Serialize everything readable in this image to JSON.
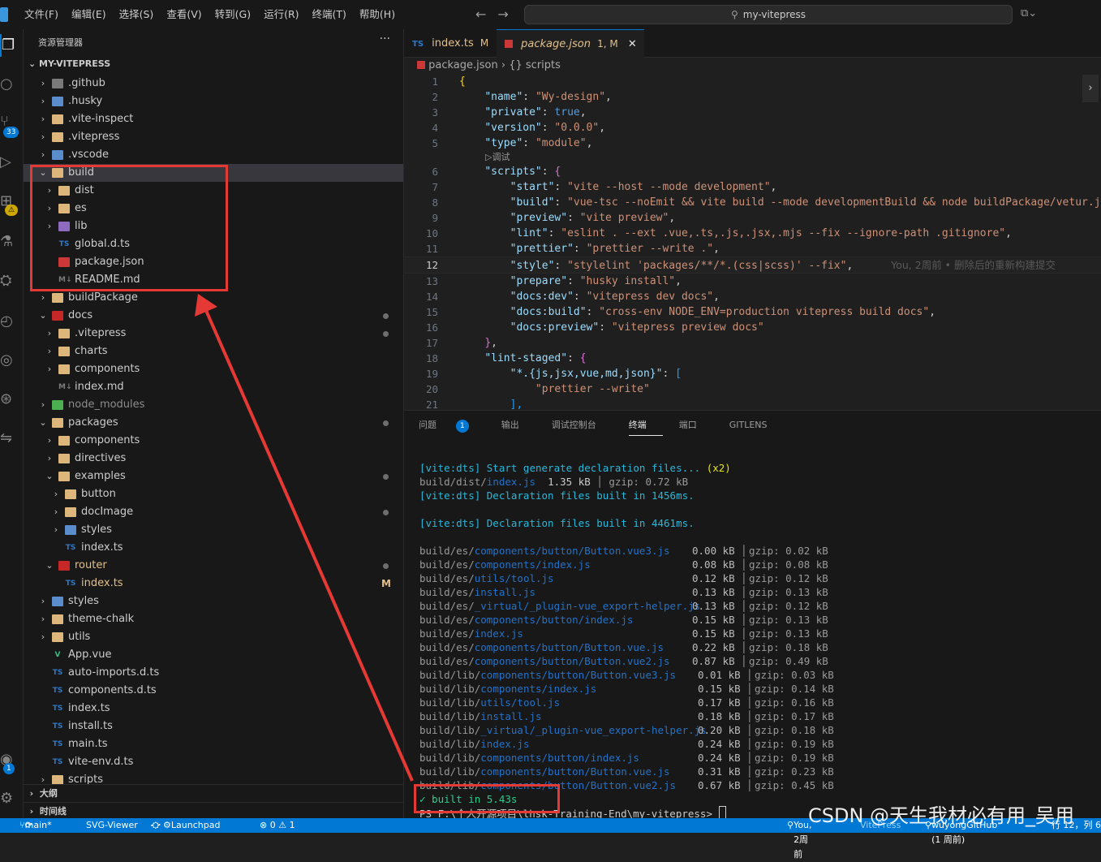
{
  "menu": [
    "文件(F)",
    "编辑(E)",
    "选择(S)",
    "查看(V)",
    "转到(G)",
    "运行(R)",
    "终端(T)",
    "帮助(H)"
  ],
  "search": {
    "text": "my-vitepress"
  },
  "activity_badges": {
    "scm": "33",
    "warn": "⚠",
    "account": "1"
  },
  "sidebar": {
    "title": "资源管理器",
    "more": "···",
    "root": "MY-VITEPRESS",
    "items": [
      {
        "label": ".github",
        "depth": 0,
        "chev": "›",
        "icon": "f-gray",
        "name": "folder-icon"
      },
      {
        "label": ".husky",
        "depth": 0,
        "chev": "›",
        "icon": "f-blue",
        "name": "folder-icon"
      },
      {
        "label": ".vite-inspect",
        "depth": 0,
        "chev": "›",
        "icon": "f-folder",
        "name": "folder-icon"
      },
      {
        "label": ".vitepress",
        "depth": 0,
        "chev": "›",
        "icon": "f-folder",
        "name": "folder-icon"
      },
      {
        "label": ".vscode",
        "depth": 0,
        "chev": "›",
        "icon": "f-blue",
        "name": "folder-icon"
      },
      {
        "label": "build",
        "depth": 0,
        "chev": "⌄",
        "icon": "f-folder",
        "name": "folder-open-icon",
        "sel": true
      },
      {
        "label": "dist",
        "depth": 1,
        "chev": "›",
        "icon": "f-folder",
        "name": "folder-icon"
      },
      {
        "label": "es",
        "depth": 1,
        "chev": "›",
        "icon": "f-folder",
        "name": "folder-icon"
      },
      {
        "label": "lib",
        "depth": 1,
        "chev": "›",
        "icon": "f-purple",
        "name": "folder-icon"
      },
      {
        "label": "global.d.ts",
        "depth": 1,
        "chev": "",
        "icon": "ts",
        "glyph": "TS",
        "name": "typescript-file-icon"
      },
      {
        "label": "package.json",
        "depth": 1,
        "chev": "",
        "icon": "pj",
        "glyph": "",
        "name": "npm-file-icon"
      },
      {
        "label": "README.md",
        "depth": 1,
        "chev": "",
        "icon": "md",
        "glyph": "M↓",
        "name": "markdown-file-icon"
      },
      {
        "label": "buildPackage",
        "depth": 0,
        "chev": "›",
        "icon": "f-folder",
        "name": "folder-icon"
      },
      {
        "label": "docs",
        "depth": 0,
        "chev": "⌄",
        "icon": "f-red",
        "name": "folder-open-icon",
        "dot": true
      },
      {
        "label": ".vitepress",
        "depth": 1,
        "chev": "›",
        "icon": "f-folder",
        "name": "folder-icon",
        "dot": true
      },
      {
        "label": "charts",
        "depth": 1,
        "chev": "›",
        "icon": "f-folder",
        "name": "folder-icon"
      },
      {
        "label": "components",
        "depth": 1,
        "chev": "›",
        "icon": "f-folder",
        "name": "folder-icon"
      },
      {
        "label": "index.md",
        "depth": 1,
        "chev": "",
        "icon": "md",
        "glyph": "M↓",
        "name": "markdown-file-icon"
      },
      {
        "label": "node_modules",
        "depth": 0,
        "chev": "›",
        "icon": "f-green",
        "name": "folder-icon",
        "dim": true
      },
      {
        "label": "packages",
        "depth": 0,
        "chev": "⌄",
        "icon": "f-folder",
        "name": "folder-open-icon",
        "dot": true
      },
      {
        "label": "components",
        "depth": 1,
        "chev": "›",
        "icon": "f-folder",
        "name": "folder-icon"
      },
      {
        "label": "directives",
        "depth": 1,
        "chev": "›",
        "icon": "f-folder",
        "name": "folder-icon"
      },
      {
        "label": "examples",
        "depth": 1,
        "chev": "⌄",
        "icon": "f-folder",
        "name": "folder-open-icon",
        "dot": true
      },
      {
        "label": "button",
        "depth": 2,
        "chev": "›",
        "icon": "f-folder",
        "name": "folder-icon"
      },
      {
        "label": "docImage",
        "depth": 2,
        "chev": "›",
        "icon": "f-folder",
        "name": "folder-icon",
        "dot": true
      },
      {
        "label": "styles",
        "depth": 2,
        "chev": "›",
        "icon": "f-blue",
        "name": "folder-icon"
      },
      {
        "label": "index.ts",
        "depth": 2,
        "chev": "",
        "icon": "ts",
        "glyph": "TS",
        "name": "typescript-file-icon"
      },
      {
        "label": "router",
        "depth": 1,
        "chev": "⌄",
        "icon": "f-red",
        "name": "folder-open-icon",
        "dot": true,
        "mod": true
      },
      {
        "label": "index.ts",
        "depth": 2,
        "chev": "",
        "icon": "ts",
        "glyph": "TS",
        "name": "typescript-file-icon",
        "mark": "M",
        "mod": true
      },
      {
        "label": "styles",
        "depth": 0,
        "chev": "›",
        "icon": "f-blue",
        "name": "folder-icon"
      },
      {
        "label": "theme-chalk",
        "depth": 0,
        "chev": "›",
        "icon": "f-folder",
        "name": "folder-icon"
      },
      {
        "label": "utils",
        "depth": 0,
        "chev": "›",
        "icon": "f-folder",
        "name": "folder-icon"
      },
      {
        "label": "App.vue",
        "depth": 0,
        "chev": "",
        "icon": "vue",
        "glyph": "V",
        "name": "vue-file-icon"
      },
      {
        "label": "auto-imports.d.ts",
        "depth": 0,
        "chev": "",
        "icon": "ts",
        "glyph": "TS",
        "name": "typescript-file-icon"
      },
      {
        "label": "components.d.ts",
        "depth": 0,
        "chev": "",
        "icon": "ts",
        "glyph": "TS",
        "name": "typescript-file-icon"
      },
      {
        "label": "index.ts",
        "depth": 0,
        "chev": "",
        "icon": "ts",
        "glyph": "TS",
        "name": "typescript-file-icon"
      },
      {
        "label": "install.ts",
        "depth": 0,
        "chev": "",
        "icon": "ts",
        "glyph": "TS",
        "name": "typescript-file-icon"
      },
      {
        "label": "main.ts",
        "depth": 0,
        "chev": "",
        "icon": "ts",
        "glyph": "TS",
        "name": "typescript-file-icon"
      },
      {
        "label": "vite-env.d.ts",
        "depth": 0,
        "chev": "",
        "icon": "ts",
        "glyph": "TS",
        "name": "typescript-file-icon"
      },
      {
        "label": "scripts",
        "depth": -1,
        "chev": "›",
        "icon": "f-folder",
        "name": "folder-icon"
      }
    ],
    "outline": "大纲",
    "timeline": "时间线"
  },
  "tabs": [
    {
      "lang": "TS",
      "label": "index.ts",
      "status": "M"
    },
    {
      "label": "package.json",
      "status": "1, M",
      "close": "✕"
    }
  ],
  "breadcrumb": {
    "file": "package.json",
    "sep": "›",
    "node": "{} scripts"
  },
  "codelens": "▷调试",
  "blame": "You, 2周前 • 删除后的重新构建提交",
  "current_line": 12,
  "code": [
    [
      [
        "{",
        "p1"
      ]
    ],
    [
      [
        "    ",
        ""
      ],
      [
        "\"name\"",
        "k"
      ],
      [
        ": ",
        ""
      ],
      [
        "\"Wy-design\"",
        "s"
      ],
      [
        ",",
        ""
      ]
    ],
    [
      [
        "    ",
        ""
      ],
      [
        "\"private\"",
        "k"
      ],
      [
        ": ",
        ""
      ],
      [
        "true",
        "b"
      ],
      [
        ",",
        ""
      ]
    ],
    [
      [
        "    ",
        ""
      ],
      [
        "\"version\"",
        "k"
      ],
      [
        ": ",
        ""
      ],
      [
        "\"0.0.0\"",
        "s"
      ],
      [
        ",",
        ""
      ]
    ],
    [
      [
        "    ",
        ""
      ],
      [
        "\"type\"",
        "k"
      ],
      [
        ": ",
        ""
      ],
      [
        "\"module\"",
        "s"
      ],
      [
        ",",
        ""
      ]
    ],
    [
      [
        "    ",
        ""
      ],
      [
        "\"scripts\"",
        "k"
      ],
      [
        ": ",
        ""
      ],
      [
        "{",
        "p2"
      ]
    ],
    [
      [
        "        ",
        ""
      ],
      [
        "\"start\"",
        "k"
      ],
      [
        ": ",
        ""
      ],
      [
        "\"vite --host --mode development\"",
        "s"
      ],
      [
        ",",
        ""
      ]
    ],
    [
      [
        "        ",
        ""
      ],
      [
        "\"build\"",
        "k"
      ],
      [
        ": ",
        ""
      ],
      [
        "\"vue-tsc --noEmit && vite build --mode developmentBuild && node buildPackage/vetur.js",
        "s"
      ]
    ],
    [
      [
        "        ",
        ""
      ],
      [
        "\"preview\"",
        "k"
      ],
      [
        ": ",
        ""
      ],
      [
        "\"vite preview\"",
        "s"
      ],
      [
        ",",
        ""
      ]
    ],
    [
      [
        "        ",
        ""
      ],
      [
        "\"lint\"",
        "k"
      ],
      [
        ": ",
        ""
      ],
      [
        "\"eslint . --ext .vue,.ts,.js,.jsx,.mjs --fix --ignore-path .gitignore\"",
        "s"
      ],
      [
        ",",
        ""
      ]
    ],
    [
      [
        "        ",
        ""
      ],
      [
        "\"prettier\"",
        "k"
      ],
      [
        ": ",
        ""
      ],
      [
        "\"prettier --write .\"",
        "s"
      ],
      [
        ",",
        ""
      ]
    ],
    [
      [
        "        ",
        ""
      ],
      [
        "\"style\"",
        "k"
      ],
      [
        ": ",
        ""
      ],
      [
        "\"stylelint 'packages/**/*.(css|scss)' --fix\"",
        "s"
      ],
      [
        ",",
        ""
      ]
    ],
    [
      [
        "        ",
        ""
      ],
      [
        "\"prepare\"",
        "k"
      ],
      [
        ": ",
        ""
      ],
      [
        "\"husky install\"",
        "s"
      ],
      [
        ",",
        ""
      ]
    ],
    [
      [
        "        ",
        ""
      ],
      [
        "\"docs:dev\"",
        "k"
      ],
      [
        ": ",
        ""
      ],
      [
        "\"vitepress dev docs\"",
        "s"
      ],
      [
        ",",
        ""
      ]
    ],
    [
      [
        "        ",
        ""
      ],
      [
        "\"docs:build\"",
        "k"
      ],
      [
        ": ",
        ""
      ],
      [
        "\"cross-env NODE_ENV=production vitepress build docs\"",
        "s"
      ],
      [
        ",",
        ""
      ]
    ],
    [
      [
        "        ",
        ""
      ],
      [
        "\"docs:preview\"",
        "k"
      ],
      [
        ": ",
        ""
      ],
      [
        "\"vitepress preview docs\"",
        "s"
      ]
    ],
    [
      [
        "    ",
        ""
      ],
      [
        "}",
        "p2"
      ],
      [
        ",",
        ""
      ]
    ],
    [
      [
        "    ",
        ""
      ],
      [
        "\"lint-staged\"",
        "k"
      ],
      [
        ": ",
        ""
      ],
      [
        "{",
        "p2"
      ]
    ],
    [
      [
        "        ",
        ""
      ],
      [
        "\"*.{js,jsx,vue,md,json}\"",
        "k"
      ],
      [
        ": ",
        ""
      ],
      [
        "[",
        "p3"
      ]
    ],
    [
      [
        "            ",
        ""
      ],
      [
        "\"prettier --write\"",
        "s"
      ]
    ],
    [
      [
        "        ",
        ""
      ],
      [
        "],",
        "p3"
      ]
    ]
  ],
  "panel": {
    "tabs": [
      "问题",
      "输出",
      "调试控制台",
      "终端",
      "端口",
      "GITLENS"
    ],
    "problems_count": "1",
    "active": "终端"
  },
  "terminal": {
    "pre": [
      {
        "a": "[vite:dts] Start generate declaration files... ",
        "b": "(x2)"
      },
      {
        "p1": "build/dist/",
        "p2": "index.js",
        "sz": "  1.35 kB",
        "gz": "│ gzip: 0.72 kB",
        "inline": true
      },
      {
        "a": "[vite:dts] Declaration files built in 1456ms."
      },
      {
        "blank": true
      },
      {
        "a": "[vite:dts] Declaration files built in 4461ms."
      },
      {
        "blank": true
      }
    ],
    "files": [
      [
        "build/es/",
        "components/button/Button.vue3.js",
        "0.00 kB",
        "gzip: 0.02 kB"
      ],
      [
        "build/es/",
        "components/index.js",
        "0.08 kB",
        "gzip: 0.08 kB"
      ],
      [
        "build/es/",
        "utils/tool.js",
        "0.12 kB",
        "gzip: 0.12 kB"
      ],
      [
        "build/es/",
        "install.js",
        "0.13 kB",
        "gzip: 0.13 kB"
      ],
      [
        "build/es/",
        "_virtual/_plugin-vue_export-helper.js",
        "0.13 kB",
        "gzip: 0.12 kB"
      ],
      [
        "build/es/",
        "components/button/index.js",
        "0.15 kB",
        "gzip: 0.13 kB"
      ],
      [
        "build/es/",
        "index.js",
        "0.15 kB",
        "gzip: 0.13 kB"
      ],
      [
        "build/es/",
        "components/button/Button.vue.js",
        "0.22 kB",
        "gzip: 0.18 kB"
      ],
      [
        "build/es/",
        "components/button/Button.vue2.js",
        "0.87 kB",
        "gzip: 0.49 kB"
      ],
      [
        "build/lib/",
        "components/button/Button.vue3.js",
        "0.01 kB",
        "gzip: 0.03 kB"
      ],
      [
        "build/lib/",
        "components/index.js",
        "0.15 kB",
        "gzip: 0.14 kB"
      ],
      [
        "build/lib/",
        "utils/tool.js",
        "0.17 kB",
        "gzip: 0.16 kB"
      ],
      [
        "build/lib/",
        "install.js",
        "0.18 kB",
        "gzip: 0.17 kB"
      ],
      [
        "build/lib/",
        "_virtual/_plugin-vue_export-helper.js",
        "0.20 kB",
        "gzip: 0.18 kB"
      ],
      [
        "build/lib/",
        "index.js",
        "0.24 kB",
        "gzip: 0.19 kB"
      ],
      [
        "build/lib/",
        "components/button/index.js",
        "0.24 kB",
        "gzip: 0.19 kB"
      ],
      [
        "build/lib/",
        "components/button/Button.vue.js",
        "0.31 kB",
        "gzip: 0.23 kB"
      ],
      [
        "build/lib/",
        "components/button/Button.vue2.js",
        "0.67 kB",
        "gzip: 0.45 kB"
      ]
    ],
    "built": "✓ built in 5.43s",
    "prompt": "PS F:\\个人开源项目\\lhsk-Training-End\\my-vitepress> "
  },
  "status": {
    "branch": "main*",
    "sync": "⟳",
    "svg": "SVG-Viewer",
    "launchpad": "Launchpad",
    "errors": "⊗ 0 ⚠ 1",
    "blame": "You, 2周前",
    "vitepress": "VitePress",
    "github": "wuyongGitHub (1 周前)",
    "position": "行 12，列 6"
  },
  "watermark": "CSDN @天生我材必有用_吴用",
  "colors": {
    "accent": "#0078d4",
    "annotation": "#e53935",
    "terminal_cyan": "#29b8db",
    "terminal_green": "#23d18b"
  }
}
